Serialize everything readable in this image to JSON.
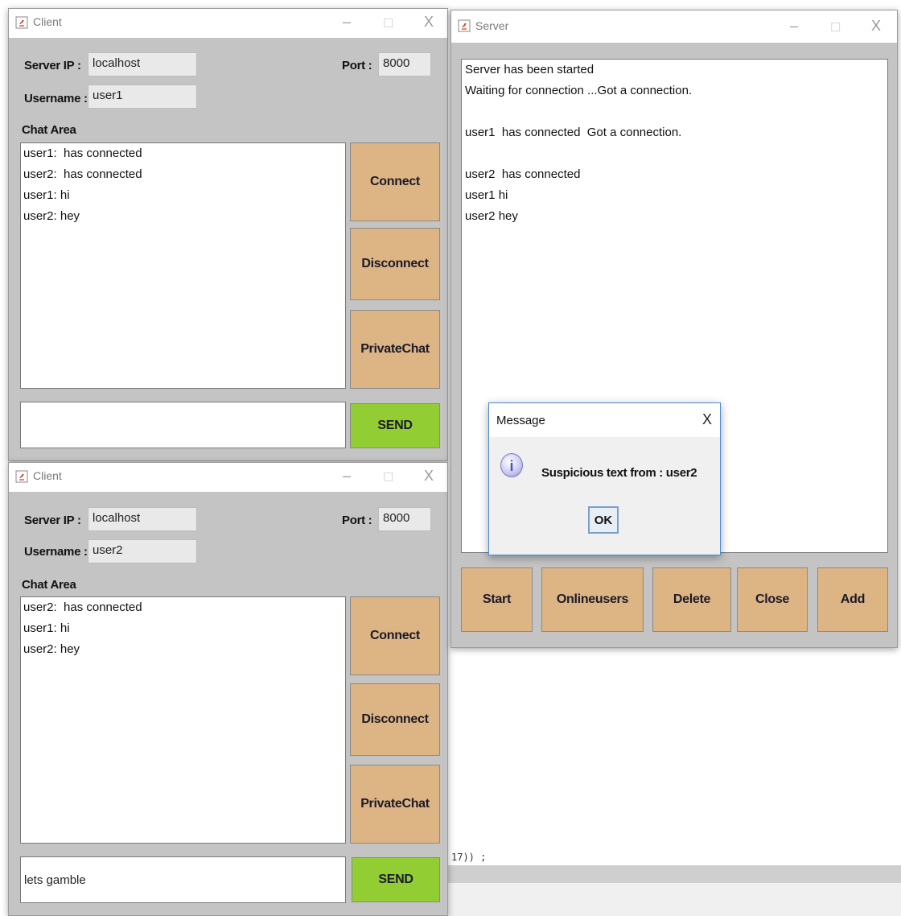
{
  "client1": {
    "title": "Client",
    "server_ip_label": "Server IP :",
    "server_ip": "localhost",
    "port_label": "Port :",
    "port": "8000",
    "username_label": "Username :",
    "username": "user1",
    "chat_area_label": "Chat Area",
    "chat_lines": [
      "user1:  has connected",
      "user2:  has connected",
      "user1: hi",
      "user2: hey"
    ],
    "buttons": {
      "connect": "Connect",
      "disconnect": "Disconnect",
      "private": "PrivateChat",
      "send": "SEND"
    },
    "message_input": ""
  },
  "client2": {
    "title": "Client",
    "server_ip_label": "Server IP :",
    "server_ip": "localhost",
    "port_label": "Port :",
    "port": "8000",
    "username_label": "Username :",
    "username": "user2",
    "chat_area_label": "Chat Area",
    "chat_lines": [
      "user2:  has connected",
      "user1: hi",
      "user2: hey"
    ],
    "buttons": {
      "connect": "Connect",
      "disconnect": "Disconnect",
      "private": "PrivateChat",
      "send": "SEND"
    },
    "message_input": "lets gamble"
  },
  "server": {
    "title": "Server",
    "log_lines": [
      "Server has been started",
      "Waiting for connection ...Got a connection.",
      "",
      "user1  has connected  Got a connection.",
      "",
      "user2  has connected",
      "user1 hi",
      "user2 hey"
    ],
    "buttons": {
      "start": "Start",
      "online": "Onlineusers",
      "delete": "Delete",
      "close": "Close",
      "add": "Add"
    }
  },
  "dialog": {
    "title": "Message",
    "close": "X",
    "message": "Suspicious text from : user2",
    "ok": "OK",
    "icon": "i"
  },
  "window_controls": {
    "minimize": "–",
    "maximize": "☐",
    "close": "X"
  },
  "background_code": "  17)) ;",
  "colors": {
    "button": "#ddb483",
    "send_button": "#92cd33",
    "window_bg": "#c4c4c4"
  }
}
